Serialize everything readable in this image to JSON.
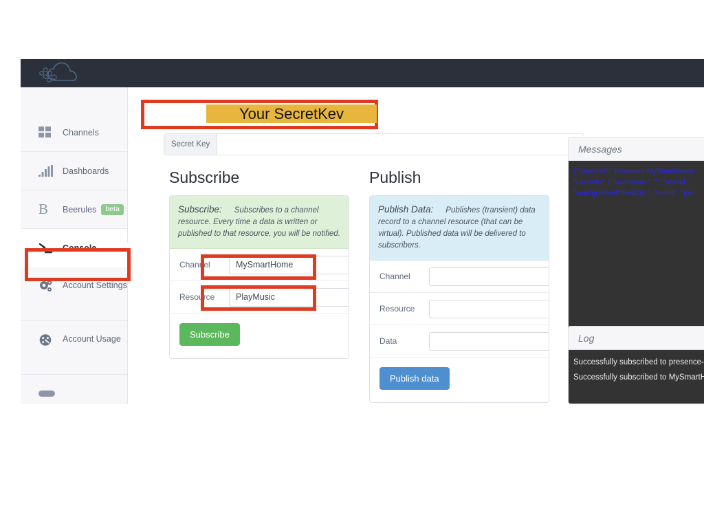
{
  "brand": {
    "logo_icon": "cloud-hexagons-logo"
  },
  "sidebar": {
    "items": [
      {
        "label": "Channels",
        "icon": "grid-squares-icon",
        "badge": ""
      },
      {
        "label": "Dashboards",
        "icon": "bar-chart-icon",
        "badge": ""
      },
      {
        "label": "Beerules",
        "icon": "letter-b-icon",
        "badge": "beta"
      },
      {
        "label": "Console",
        "icon": "terminal-prompt-icon",
        "badge": ""
      },
      {
        "label": "Account Settings",
        "icon": "gears-icon",
        "badge": ""
      },
      {
        "label": "Account Usage",
        "icon": "gauge-icon",
        "badge": ""
      }
    ]
  },
  "secret_key": {
    "addon_label": "Secret Key",
    "value": "",
    "placeholder": "",
    "overlay_text": "Your SecretKev"
  },
  "subscribe": {
    "title": "Subscribe",
    "alert_lead": "Subscribe:",
    "alert_text": "Subscribes to a channel resource. Every time a data is written or published to that resource, you will be notified.",
    "channel_label": "Channel",
    "channel_value": "MySmartHome",
    "resource_label": "Resource",
    "resource_value": "PlayMusic",
    "button_label": "Subscribe"
  },
  "publish": {
    "title": "Publish",
    "alert_lead": "Publish Data:",
    "alert_text": "Publishes (transient) data record to a channel resource (that can be virtual). Published data will be delivered to subscribers.",
    "channel_label": "Channel",
    "channel_value": "",
    "resource_label": "Resource",
    "resource_value": "",
    "data_label": "Data",
    "data_value": "",
    "button_label": "Publish data"
  },
  "messages": {
    "title": "Messages",
    "lines": [
      "{ \"channel\": \"presence-MySmartHome",
      "\"userinfo\": { \"username\": \"\", \"userid\":",
      "\"seafIgrIXAhIPffwADG-\", \"event\": \"join"
    ]
  },
  "log": {
    "title": "Log",
    "lines": [
      "Successfully subscribed to presence-M",
      "Successfully subscribed to MySmartH"
    ]
  },
  "annotations": {
    "color": "#e03b21",
    "highlight_color": "#e8b63c",
    "boxes": [
      "secret-key-box",
      "console-nav-box",
      "subscribe-channel-box",
      "subscribe-resource-box"
    ]
  }
}
